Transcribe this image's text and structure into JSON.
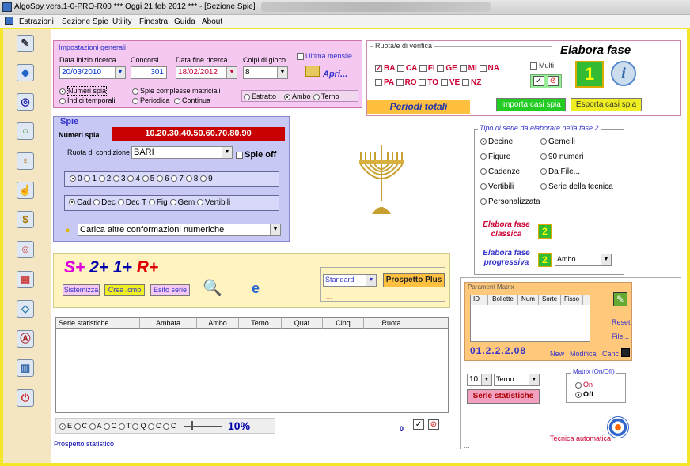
{
  "title": "AlgoSpy vers.1-0-PRO-R00  ***  Oggi 21 feb 2012  ***  - [Sezione Spie]",
  "menu": [
    "Estrazioni",
    "Sezione Spie",
    "Utility",
    "Finestra",
    "Guida",
    "About"
  ],
  "toolbar_icons": [
    "pencil-icon",
    "diamond-icon",
    "target-icon",
    "ring-icon",
    "bulb-icon",
    "hand-icon",
    "dollar-icon",
    "people-icon",
    "grid-icon",
    "shape-icon",
    "letter-a-icon",
    "book-icon",
    "power-icon"
  ],
  "impostazioni": {
    "heading": "Impostazioni generali",
    "data_inizio_label": "Data inizio ricerca",
    "data_inizio": "20/03/2010",
    "concorsi_label": "Concorsi",
    "concorsi": "301",
    "data_fine_label": "Data fine ricerca",
    "data_fine": "18/02/2012",
    "colpi_label": "Colpi di gioco",
    "colpi": "8",
    "ultima_mensile": "Ultima mensile",
    "apri": "Apri...",
    "radio_numeri_spia": "Numeri spia",
    "radio_indici": "Indici temporali",
    "radio_spie_complesse": "Spie complesse matriciali",
    "radio_periodica": "Periodica",
    "radio_continua": "Continua",
    "radio_estratto": "Estratto",
    "radio_ambo": "Ambo",
    "radio_terno": "Terno"
  },
  "ruote": {
    "heading": "Ruota/e di verifica",
    "row1": [
      "BA",
      "CA",
      "FI",
      "GE",
      "MI",
      "NA"
    ],
    "row2": [
      "PA",
      "RO",
      "TO",
      "VE",
      "NZ"
    ],
    "multi": "Multi",
    "periodi_totali": "Periodi totali"
  },
  "elabora": {
    "title": "Elabora fase",
    "num": "1",
    "importa": "Importa casi spia",
    "esporta": "Esporta casi spia"
  },
  "spie": {
    "heading": "Spie",
    "numeri_spia_label": "Numeri spia",
    "numeri_spia": "10.20.30.40.50.60.70.80.90",
    "ruota_label": "Ruota di condizione",
    "ruota": "BARI",
    "spie_off": "Spie off",
    "digits": [
      "0",
      "1",
      "2",
      "3",
      "4",
      "5",
      "6",
      "7",
      "8",
      "9"
    ],
    "types": [
      "Cad",
      "Dec",
      "Dec T",
      "Fig",
      "Gem",
      "Vertibili"
    ],
    "carica": "Carica altre conformazioni numeriche"
  },
  "tipo_serie": {
    "heading": "Tipo di serie da elaborare nella fase 2",
    "col1": [
      "Decine",
      "Figure",
      "Cadenze",
      "Vertibili",
      "Personalizzata"
    ],
    "col2": [
      "Gemelli",
      "90 numeri",
      "Da File...",
      "Serie della tecnica"
    ],
    "classica": "Elabora fase classica",
    "progressiva": "Elabora fase progressiva",
    "num2": "2",
    "progressiva_combo": "Ambo"
  },
  "sistema": {
    "s": "S+",
    "two": "2+",
    "one": "1+",
    "r": "R+",
    "sistemizza": "Sistemizza",
    "crea": "Crea .cmb",
    "esito": "Esito serie",
    "standard": "Standard",
    "prospetto_plus": "Prospetto Plus",
    "dots": "..."
  },
  "table": {
    "headers": [
      "Serie statistiche",
      "Ambata",
      "Ambo",
      "Terno",
      "Quat",
      "Cinq",
      "Ruota"
    ]
  },
  "matrix": {
    "heading": "Parametri Matrix",
    "headers": [
      "ID",
      "Bollette",
      "Num",
      "Sorte",
      "Fisso"
    ],
    "code": "01.2.2.2.08",
    "new": "New",
    "modifica": "Modifica",
    "canc": "Canc",
    "reset": "Reset",
    "file": "File...",
    "onoff_label": "Matrix (On/Off)",
    "on": "On",
    "off": "Off",
    "n": "10",
    "sorte": "Terno",
    "serie_statistiche": "Serie statistiche",
    "dots": "...",
    "tecnica": "Tecnica automatica"
  },
  "bottom": {
    "radios": [
      "E",
      "C",
      "A",
      "C",
      "T",
      "Q",
      "C",
      "C"
    ],
    "percent": "10%",
    "zero": "0",
    "prospetto": "Prospetto statistico"
  }
}
